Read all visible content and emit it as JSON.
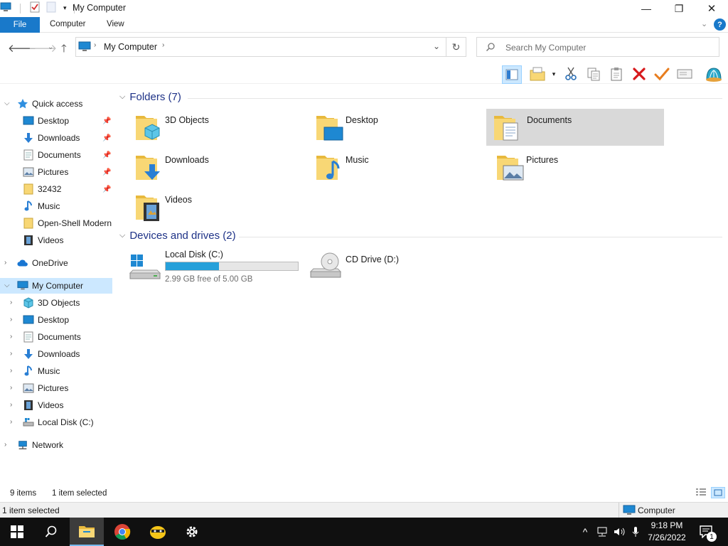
{
  "window": {
    "title": "My Computer",
    "minimize": "—",
    "restore": "❐",
    "close": "✕"
  },
  "ribbon": {
    "file": "File",
    "tabs": [
      "Computer",
      "View"
    ],
    "help": "?"
  },
  "address": {
    "breadcrumb": "My Computer",
    "search_placeholder": "Search My Computer"
  },
  "navigation": {
    "quick_access": {
      "label": "Quick access",
      "items": [
        {
          "label": "Desktop",
          "pinned": true
        },
        {
          "label": "Downloads",
          "pinned": true
        },
        {
          "label": "Documents",
          "pinned": true
        },
        {
          "label": "Pictures",
          "pinned": true
        },
        {
          "label": "32432",
          "pinned": true
        },
        {
          "label": "Music",
          "pinned": false
        },
        {
          "label": "Open-Shell Modern",
          "pinned": false
        },
        {
          "label": "Videos",
          "pinned": false
        }
      ]
    },
    "onedrive": "OneDrive",
    "my_computer": {
      "label": "My Computer",
      "items": [
        "3D Objects",
        "Desktop",
        "Documents",
        "Downloads",
        "Music",
        "Pictures",
        "Videos",
        "Local Disk (C:)"
      ]
    },
    "network": "Network"
  },
  "content": {
    "folders_header": "Folders (7)",
    "folders": [
      {
        "name": "3D Objects",
        "icon": "3d-objects-folder-icon"
      },
      {
        "name": "Desktop",
        "icon": "desktop-folder-icon"
      },
      {
        "name": "Documents",
        "icon": "documents-folder-icon",
        "selected": true
      },
      {
        "name": "Downloads",
        "icon": "downloads-folder-icon"
      },
      {
        "name": "Music",
        "icon": "music-folder-icon"
      },
      {
        "name": "Pictures",
        "icon": "pictures-folder-icon"
      },
      {
        "name": "Videos",
        "icon": "videos-folder-icon"
      }
    ],
    "drives_header": "Devices and drives (2)",
    "drives": [
      {
        "name": "Local Disk (C:)",
        "free_text": "2.99 GB free of 5.00 GB",
        "used_fraction": 0.402
      },
      {
        "name": "CD Drive (D:)"
      }
    ]
  },
  "status": {
    "items_count": "9 items",
    "selected_count": "1 item selected",
    "bottom_left": "1 item selected",
    "bottom_right": "Computer"
  },
  "taskbar": {
    "time": "9:18 PM",
    "date": "7/26/2022",
    "notification_count": "1"
  },
  "colors": {
    "accent": "#1979ca",
    "selection": "#cce8ff",
    "tile_selected": "#d9d9d9",
    "drive_bar": "#26a0da",
    "folder_yellow": "#f8d775",
    "group_header": "#1e3287"
  }
}
